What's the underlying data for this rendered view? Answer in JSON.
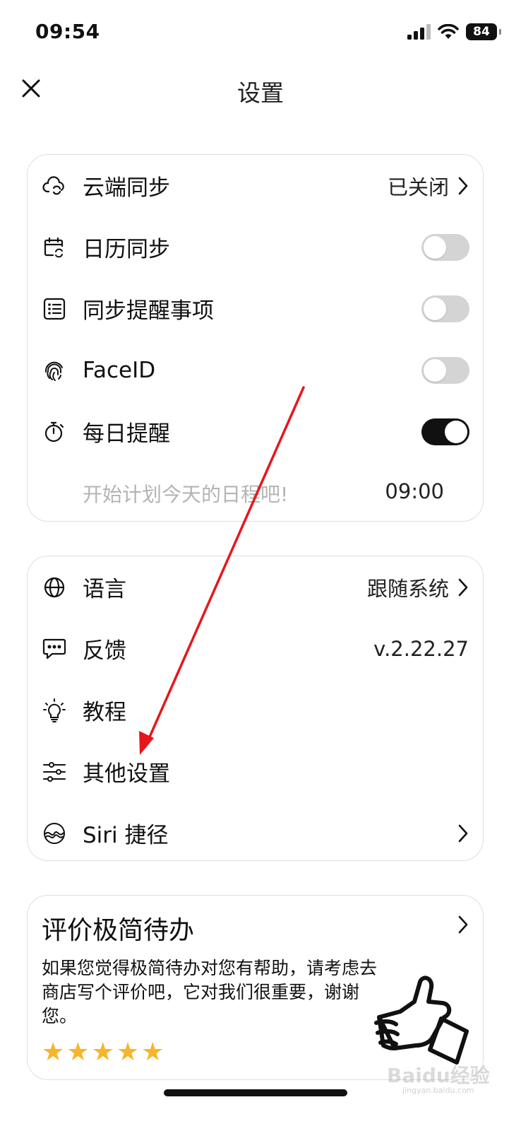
{
  "status_bar": {
    "time": "09:54",
    "battery": "84"
  },
  "nav": {
    "title": "设置"
  },
  "group1": {
    "cloud_sync": {
      "label": "云端同步",
      "value": "已关闭"
    },
    "calendar_sync": {
      "label": "日历同步",
      "enabled": false
    },
    "sync_reminders": {
      "label": "同步提醒事项",
      "enabled": false
    },
    "face_id": {
      "label": "FaceID",
      "enabled": false
    },
    "daily_reminder": {
      "label": "每日提醒",
      "enabled": true
    },
    "reminder_message": {
      "text": "开始计划今天的日程吧!",
      "time": "09:00"
    }
  },
  "group2": {
    "language": {
      "label": "语言",
      "value": "跟随系统"
    },
    "feedback": {
      "label": "反馈",
      "value": "v.2.22.27"
    },
    "tutorial": {
      "label": "教程"
    },
    "other_settings": {
      "label": "其他设置"
    },
    "siri_shortcuts": {
      "label": "Siri 捷径"
    }
  },
  "rate_card": {
    "title": "评价极简待办",
    "description": "如果您觉得极简待办对您有帮助，请考虑去商店写个评价吧，它对我们很重要，谢谢您。",
    "stars": [
      "★",
      "★",
      "★",
      "★",
      "★"
    ]
  },
  "watermark": {
    "text": "Baidu经验",
    "sub": "jingyan.baidu.com"
  },
  "colors": {
    "star": "#f7b52c",
    "toggle_off": "#d4d4d4",
    "toggle_on": "#111111",
    "annotation_arrow": "#e8161b"
  },
  "icons": [
    "cloud-sync-icon",
    "calendar-sync-icon",
    "list-icon",
    "fingerprint-icon",
    "timer-icon",
    "globe-icon",
    "chat-icon",
    "lightbulb-icon",
    "sliders-icon",
    "siri-icon",
    "chevron-right-icon",
    "thumbs-up-icon"
  ]
}
